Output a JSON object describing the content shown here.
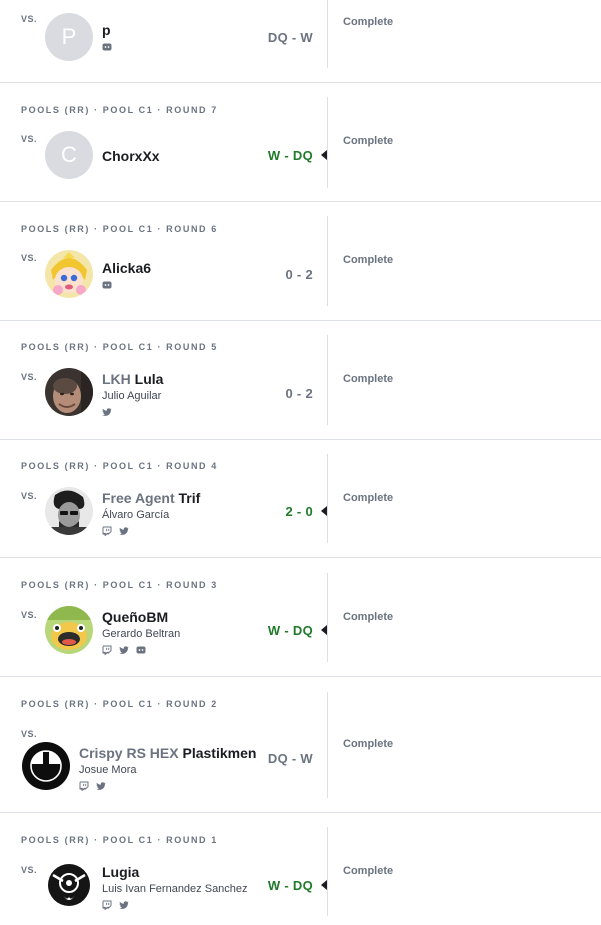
{
  "vs_label": "VS.",
  "matches": [
    {
      "round": "",
      "avatar": {
        "type": "initial",
        "letter": "P"
      },
      "prefix": "",
      "gamertag": "p",
      "real_name": "",
      "socials": [
        "discord"
      ],
      "score": "DQ - W",
      "result": "loss",
      "status": "Complete"
    },
    {
      "round": "POOLS (RR) · POOL C1 · ROUND 7",
      "avatar": {
        "type": "initial",
        "letter": "C"
      },
      "prefix": "",
      "gamertag": "ChorxXx",
      "real_name": "",
      "socials": [],
      "score": "W - DQ",
      "result": "win",
      "status": "Complete"
    },
    {
      "round": "POOLS (RR) · POOL C1 · ROUND 6",
      "avatar": {
        "type": "image",
        "icon": "cartoon-peach-avatar"
      },
      "prefix": "",
      "gamertag": "Alicka6",
      "real_name": "",
      "socials": [
        "discord"
      ],
      "score": "0 - 2",
      "result": "loss",
      "status": "Complete"
    },
    {
      "round": "POOLS (RR) · POOL C1 · ROUND 5",
      "avatar": {
        "type": "image",
        "icon": "face-photo-avatar"
      },
      "prefix": "LKH",
      "gamertag": "Lula",
      "real_name": "Julio Aguilar",
      "socials": [
        "twitter"
      ],
      "score": "0 - 2",
      "result": "loss",
      "status": "Complete"
    },
    {
      "round": "POOLS (RR) · POOL C1 · ROUND 4",
      "avatar": {
        "type": "image",
        "icon": "bw-portrait-avatar"
      },
      "prefix": "Free Agent",
      "gamertag": "Trif",
      "real_name": "Álvaro García",
      "socials": [
        "twitch",
        "twitter"
      ],
      "score": "2 - 0",
      "result": "win",
      "status": "Complete"
    },
    {
      "round": "POOLS (RR) · POOL C1 · ROUND 3",
      "avatar": {
        "type": "image",
        "icon": "cartoon-frog-avatar"
      },
      "prefix": "",
      "gamertag": "QueñoBM",
      "real_name": "Gerardo Beltran",
      "socials": [
        "twitch",
        "twitter",
        "discord"
      ],
      "score": "W - DQ",
      "result": "win",
      "status": "Complete"
    },
    {
      "round": "POOLS (RR) · POOL C1 · ROUND 2",
      "avatar": {
        "type": "image",
        "icon": "smash-logo-avatar"
      },
      "prefix": "Crispy RS HEX",
      "gamertag": "Plastikmen",
      "real_name": "Josue Mora",
      "socials": [
        "twitch",
        "twitter"
      ],
      "score": "DQ - W",
      "result": "loss",
      "status": "Complete"
    },
    {
      "round": "POOLS (RR) · POOL C1 · ROUND 1",
      "avatar": {
        "type": "image",
        "icon": "dark-emblem-avatar"
      },
      "prefix": "",
      "gamertag": "Lugia",
      "real_name": "Luis Ivan Fernandez Sanchez",
      "socials": [
        "twitch",
        "twitter"
      ],
      "score": "W - DQ",
      "result": "win",
      "status": "Complete"
    }
  ],
  "colors": {
    "win": "#1f7a2a",
    "loss": "#6b7380",
    "separator": "#dcdfe3"
  }
}
